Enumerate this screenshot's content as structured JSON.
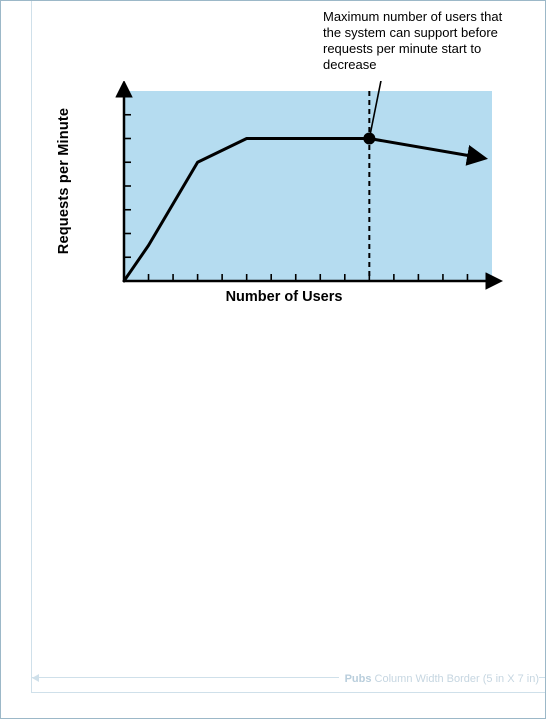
{
  "annotation": {
    "text": "Maximum number of users that the system can support before requests per minute start to decrease"
  },
  "footer": {
    "bold": "Pubs",
    "rest": " Column Width Border (5 in X 7 in)"
  },
  "chart_data": {
    "type": "line",
    "title": "",
    "xlabel": "Number of Users",
    "ylabel": "Requests per Minute",
    "xlim": [
      0,
      15
    ],
    "ylim": [
      0,
      8
    ],
    "x_ticks": [
      1,
      2,
      3,
      4,
      5,
      6,
      7,
      8,
      9,
      10,
      11,
      12,
      13,
      14
    ],
    "y_ticks": [
      1,
      2,
      3,
      4,
      5,
      6,
      7
    ],
    "x": [
      0,
      1,
      3,
      5,
      10,
      14.5
    ],
    "y": [
      0,
      1.5,
      5.0,
      6.0,
      6.0,
      5.2
    ],
    "marker": {
      "x": 10,
      "y": 6.0,
      "note": "peak throughput point"
    },
    "vline_x": 10,
    "annotation_leader": {
      "from_x": 10,
      "from_y": 6.0,
      "to_screen": "top-right"
    }
  }
}
